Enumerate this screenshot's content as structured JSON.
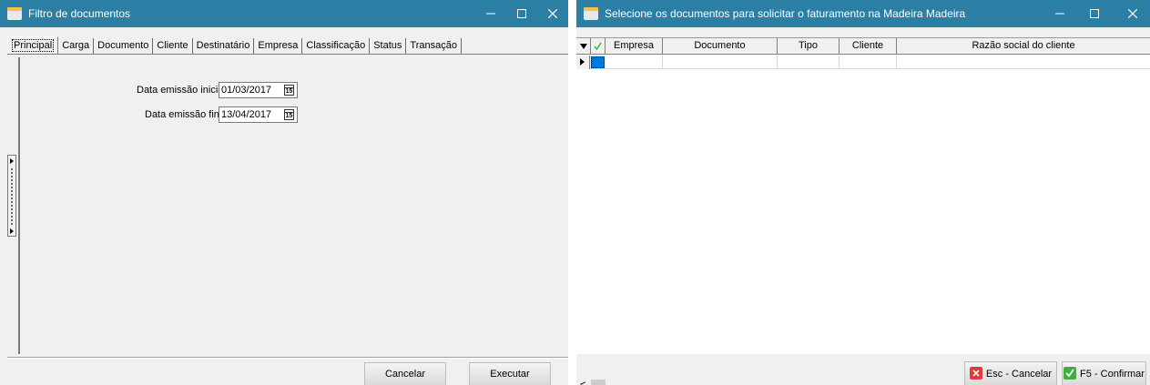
{
  "left_window": {
    "title": "Filtro de documentos",
    "tabs": [
      "Principal",
      "Carga",
      "Documento",
      "Cliente",
      "Destinatário",
      "Empresa",
      "Classificação",
      "Status",
      "Transação"
    ],
    "fields": {
      "start_label": "Data emissão inicial",
      "start_value": "01/03/2017",
      "end_label": "Data emissão final",
      "end_value": "13/04/2017"
    },
    "cancel_label": "Cancelar",
    "execute_label": "Executar"
  },
  "right_window": {
    "title": "Selecione os documentos para solicitar o faturamento na Madeira Madeira",
    "columns": [
      "Empresa",
      "Documento",
      "Tipo",
      "Cliente",
      "Razão social do cliente"
    ],
    "cancel_label": "Esc - Cancelar",
    "confirm_label": "F5 - Confirmar"
  },
  "colors": {
    "titlebar": "#2b7fa5",
    "selection": "#0078d7",
    "cancel_icon": "#e03a3a",
    "confirm_icon": "#3fae3f"
  },
  "icons": [
    "app-icon",
    "minimize-icon",
    "maximize-icon",
    "close-icon",
    "calendar-icon",
    "cancel-x-icon",
    "confirm-check-icon"
  ]
}
